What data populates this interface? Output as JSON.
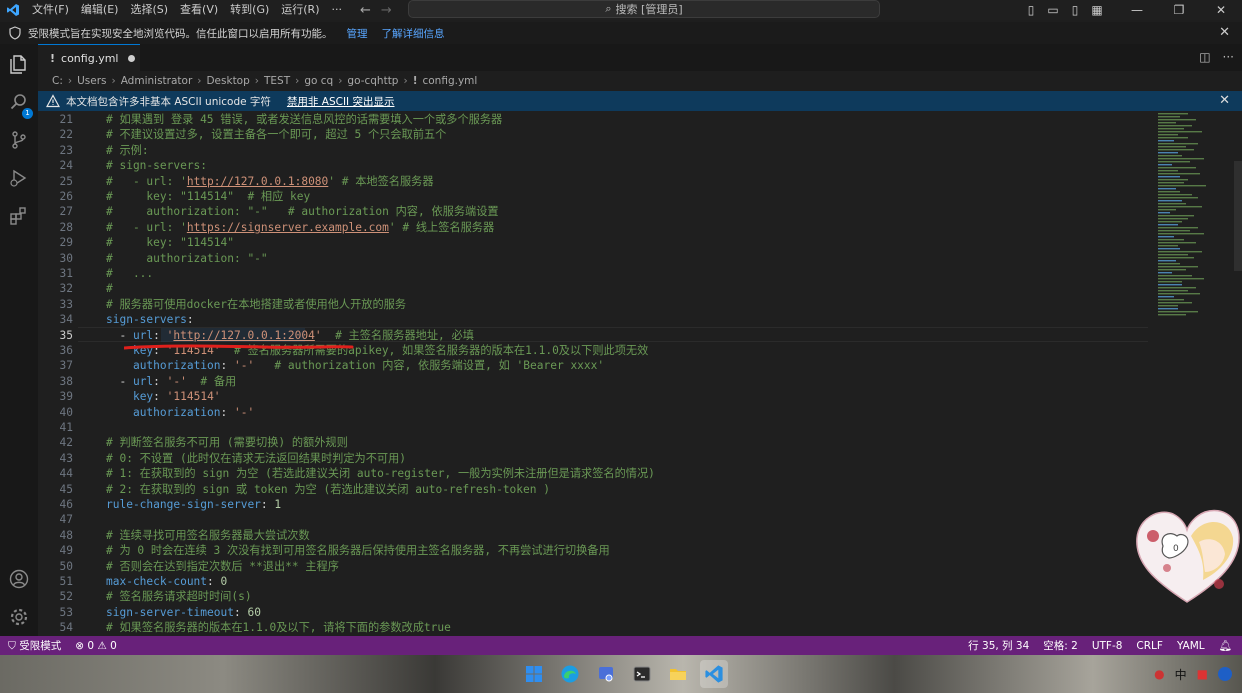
{
  "menu": [
    "文件(F)",
    "编辑(E)",
    "选择(S)",
    "查看(V)",
    "转到(G)",
    "运行(R)",
    "···"
  ],
  "command_search": "搜索 [管理员]",
  "restricted_banner": {
    "text": "受限模式旨在实现安全地浏览代码。信任此窗口以启用所有功能。",
    "manage": "管理",
    "learn_more": "了解详细信息"
  },
  "activity_badge": "1",
  "tab": {
    "filename": "config.yml"
  },
  "breadcrumb": [
    "C:",
    "Users",
    "Administrator",
    "Desktop",
    "TEST",
    "go cq",
    "go-cqhttp",
    "config.yml"
  ],
  "unicode_banner": {
    "text": "本文档包含许多非基本 ASCII unicode 字符",
    "action": "禁用非 ASCII 突出显示"
  },
  "editor": {
    "current_line": 35,
    "lines": [
      {
        "n": "21",
        "parts": [
          [
            "c-cm",
            "# 如果遇到 登录 45 错误, 或者发送信息风控的话需要填入一个或多个服务器"
          ]
        ]
      },
      {
        "n": "22",
        "parts": [
          [
            "c-cm",
            "# 不建议设置过多, 设置主备各一个即可, 超过 5 个只会取前五个"
          ]
        ]
      },
      {
        "n": "23",
        "parts": [
          [
            "c-cm",
            "# 示例:"
          ]
        ]
      },
      {
        "n": "24",
        "parts": [
          [
            "c-cm",
            "# sign-servers:"
          ]
        ]
      },
      {
        "n": "25",
        "parts": [
          [
            "c-cm",
            "#   - url: '"
          ],
          [
            "c-link",
            "http://127.0.0.1:8080"
          ],
          [
            "c-cm",
            "' # 本地签名服务器"
          ]
        ]
      },
      {
        "n": "26",
        "parts": [
          [
            "c-cm",
            "#     key: \"114514\"  # 相应 key"
          ]
        ]
      },
      {
        "n": "27",
        "parts": [
          [
            "c-cm",
            "#     authorization: \"-\"   # authorization 内容, 依服务端设置"
          ]
        ]
      },
      {
        "n": "28",
        "parts": [
          [
            "c-cm",
            "#   - url: '"
          ],
          [
            "c-link",
            "https://signserver.example.com"
          ],
          [
            "c-cm",
            "' # 线上签名服务器"
          ]
        ]
      },
      {
        "n": "29",
        "parts": [
          [
            "c-cm",
            "#     key: \"114514\""
          ]
        ]
      },
      {
        "n": "30",
        "parts": [
          [
            "c-cm",
            "#     authorization: \"-\""
          ]
        ]
      },
      {
        "n": "31",
        "parts": [
          [
            "c-cm",
            "#   ..."
          ]
        ]
      },
      {
        "n": "32",
        "parts": [
          [
            "c-cm",
            "#"
          ]
        ]
      },
      {
        "n": "33",
        "parts": [
          [
            "c-cm",
            "# 服务器可使用docker在本地搭建或者使用他人开放的服务"
          ]
        ]
      },
      {
        "n": "34",
        "parts": [
          [
            "c-key",
            "sign-servers"
          ],
          [
            "c-p",
            ":"
          ]
        ]
      },
      {
        "n": "35",
        "parts": [
          [
            "c-p",
            "  - "
          ],
          [
            "c-key",
            "url"
          ],
          [
            "c-p",
            ": "
          ],
          [
            "c-str",
            "'"
          ],
          [
            "c-link",
            "http://127.0.0.1:2004"
          ],
          [
            "c-str",
            "'"
          ],
          [
            "c-cm",
            "  # 主签名服务器地址, 必填"
          ]
        ]
      },
      {
        "n": "36",
        "parts": [
          [
            "c-p",
            "    "
          ],
          [
            "c-key",
            "key"
          ],
          [
            "c-p",
            ": "
          ],
          [
            "c-str",
            "'114514'"
          ],
          [
            "c-cm",
            "  # 签名服务器所需要的apikey, 如果签名服务器的版本在1.1.0及以下则此项无效"
          ]
        ]
      },
      {
        "n": "37",
        "parts": [
          [
            "c-p",
            "    "
          ],
          [
            "c-key",
            "authorization"
          ],
          [
            "c-p",
            ": "
          ],
          [
            "c-str",
            "'-'"
          ],
          [
            "c-cm",
            "   # authorization 内容, 依服务端设置, 如 'Bearer xxxx'"
          ]
        ]
      },
      {
        "n": "38",
        "parts": [
          [
            "c-p",
            "  - "
          ],
          [
            "c-key",
            "url"
          ],
          [
            "c-p",
            ": "
          ],
          [
            "c-str",
            "'-'"
          ],
          [
            "c-cm",
            "  # 备用"
          ]
        ]
      },
      {
        "n": "39",
        "parts": [
          [
            "c-p",
            "    "
          ],
          [
            "c-key",
            "key"
          ],
          [
            "c-p",
            ": "
          ],
          [
            "c-str",
            "'114514'"
          ]
        ]
      },
      {
        "n": "40",
        "parts": [
          [
            "c-p",
            "    "
          ],
          [
            "c-key",
            "authorization"
          ],
          [
            "c-p",
            ": "
          ],
          [
            "c-str",
            "'-'"
          ]
        ]
      },
      {
        "n": "41",
        "parts": []
      },
      {
        "n": "42",
        "parts": [
          [
            "c-cm",
            "# 判断签名服务不可用 (需要切换) 的额外规则"
          ]
        ]
      },
      {
        "n": "43",
        "parts": [
          [
            "c-cm",
            "# 0: 不设置 (此时仅在请求无法返回结果时判定为不可用)"
          ]
        ]
      },
      {
        "n": "44",
        "parts": [
          [
            "c-cm",
            "# 1: 在获取到的 sign 为空 (若选此建议关闭 auto-register, 一般为实例未注册但是请求签名的情况)"
          ]
        ]
      },
      {
        "n": "45",
        "parts": [
          [
            "c-cm",
            "# 2: 在获取到的 sign 或 token 为空 (若选此建议关闭 auto-refresh-token )"
          ]
        ]
      },
      {
        "n": "46",
        "parts": [
          [
            "c-key",
            "rule-change-sign-server"
          ],
          [
            "c-p",
            ": "
          ],
          [
            "c-num",
            "1"
          ]
        ]
      },
      {
        "n": "47",
        "parts": []
      },
      {
        "n": "48",
        "parts": [
          [
            "c-cm",
            "# 连续寻找可用签名服务器最大尝试次数"
          ]
        ]
      },
      {
        "n": "49",
        "parts": [
          [
            "c-cm",
            "# 为 0 时会在连续 3 次没有找到可用签名服务器后保持使用主签名服务器, 不再尝试进行切换备用"
          ]
        ]
      },
      {
        "n": "50",
        "parts": [
          [
            "c-cm",
            "# 否则会在达到指定次数后 **退出** 主程序"
          ]
        ]
      },
      {
        "n": "51",
        "parts": [
          [
            "c-key",
            "max-check-count"
          ],
          [
            "c-p",
            ": "
          ],
          [
            "c-num",
            "0"
          ]
        ]
      },
      {
        "n": "52",
        "parts": [
          [
            "c-cm",
            "# 签名服务请求超时时间(s)"
          ]
        ]
      },
      {
        "n": "53",
        "parts": [
          [
            "c-key",
            "sign-server-timeout"
          ],
          [
            "c-p",
            ": "
          ],
          [
            "c-num",
            "60"
          ]
        ]
      },
      {
        "n": "54",
        "parts": [
          [
            "c-cm",
            "# 如果签名服务器的版本在1.1.0及以下, 请将下面的参数改成true"
          ]
        ]
      }
    ]
  },
  "status": {
    "mode": "受限模式",
    "errors": "0",
    "warnings": "0",
    "position": "行 35, 列 34",
    "spaces": "空格: 2",
    "encoding": "UTF-8",
    "eol": "CRLF",
    "language": "YAML"
  },
  "tray": {
    "ime": "中"
  },
  "sticker_text": "0",
  "colors": {
    "status_bar": "#68217a",
    "accent": "#0078d4",
    "unicode_banner": "#0e3a5c"
  }
}
